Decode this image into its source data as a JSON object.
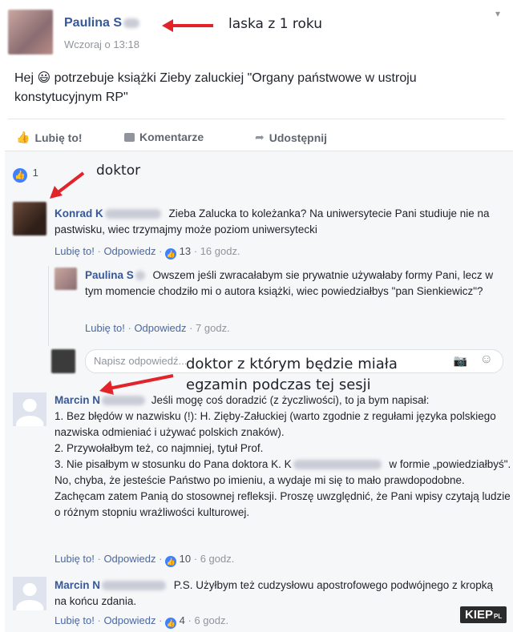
{
  "post": {
    "author": "Paulina S",
    "time": "Wczoraj o 13:18",
    "text": "Hej 😃 potrzebuje książki Zieby zaluckiej \"Organy państwowe w ustroju konstytucyjnym RP\"",
    "actions": {
      "like": "Lubię to!",
      "comment": "Komentarze",
      "share": "Udostępnij"
    },
    "like_count": "1"
  },
  "annotations": {
    "first": "laska z 1 roku",
    "second": "doktor",
    "third_line1": "doktor z którym będzie miała",
    "third_line2": "egzamin podczas tej sesji"
  },
  "comments": [
    {
      "author": "Konrad K",
      "text": "Zieba Zalucka to koleżanka? Na uniwersytecie Pani studiuje nie na pastwisku, wiec trzymajmy może poziom uniwersytecki",
      "like": "Lubię to!",
      "reply": "Odpowiedz",
      "likes": "13",
      "time": "16 godz."
    },
    {
      "author": "Paulina S",
      "text": "Owszem jeśli zwracałabym sie prywatnie używałaby formy Pani, lecz w tym momencie chodziło mi o autora książki, wiec powiedziałbys \"pan Sienkiewicz\"?",
      "like": "Lubię to!",
      "reply": "Odpowiedz",
      "time": "7 godz."
    },
    {
      "author": "Marcin N",
      "lines": [
        "Jeśli mogę coś doradzić (z życzliwości), to ja bym napisał:",
        "1. Bez błędów w nazwisku (!): H. Zięby-Załuckiej (warto zgodnie z regułami języka polskiego nazwiska odmieniać i używać polskich znaków).",
        "2. Przywołałbym też, co najmniej, tytuł Prof.",
        "3. Nie pisałbym w stosunku do Pana doktora K. K",
        "w formie „powiedziałbyś\". No, chyba, że jesteście Państwo po imieniu, a wydaje mi się to mało prawdopodobne.",
        "Zachęcam zatem Panią do stosownej refleksji. Proszę uwzględnić, że Pani wpisy czytają ludzie o różnym stopniu wrażliwości kulturowej."
      ],
      "like": "Lubię to!",
      "reply": "Odpowiedz",
      "likes": "10",
      "time": "6 godz."
    },
    {
      "author": "Marcin N",
      "text": "P.S. Użyłbym też cudzysłowu apostrofowego podwójnego z kropką na końcu zdania.",
      "like": "Lubię to!",
      "reply": "Odpowiedz",
      "likes": "4",
      "time": "6 godz."
    }
  ],
  "reply_input": {
    "placeholder": "Napisz odpowiedź..."
  },
  "watermark": "KIEP",
  "watermark_suffix": "PL",
  "colors": {
    "link": "#365899",
    "meta": "#90949c",
    "arrow": "#e0242a",
    "like_blue": "#4080ff"
  }
}
